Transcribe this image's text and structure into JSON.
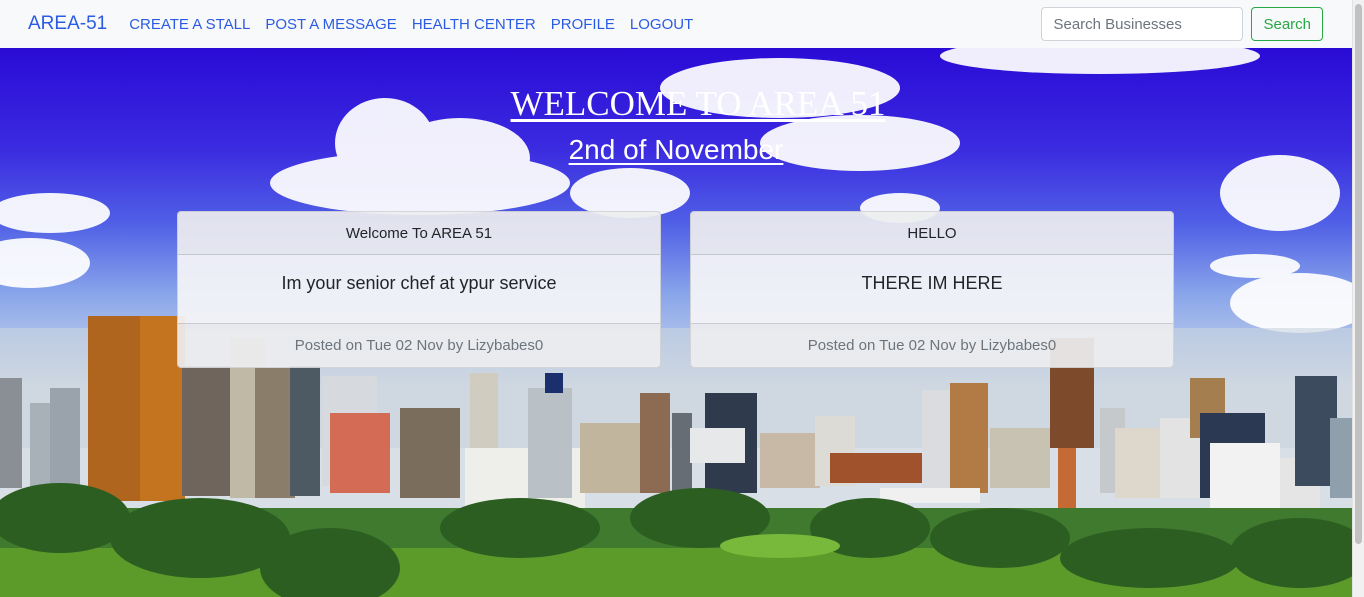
{
  "navbar": {
    "brand": "AREA-51",
    "links": [
      "CREATE A STALL",
      "POST A MESSAGE",
      "HEALTH CENTER",
      "PROFILE",
      "LOGOUT"
    ],
    "search_placeholder": "Search Businesses",
    "search_button": "Search"
  },
  "hero": {
    "title": "WELCOME TO AREA 51",
    "date": "2nd of November"
  },
  "posts": [
    {
      "title": "Welcome To AREA 51",
      "body": "Im your senior chef at ypur service",
      "footer": "Posted on Tue 02 Nov by Lizybabes0"
    },
    {
      "title": "HELLO",
      "body": "THERE IM HERE",
      "footer": "Posted on Tue 02 Nov by Lizybabes0"
    }
  ],
  "colors": {
    "link": "#2b5be3",
    "search_button": "#28a745",
    "sky_top": "#2a0bd6"
  }
}
